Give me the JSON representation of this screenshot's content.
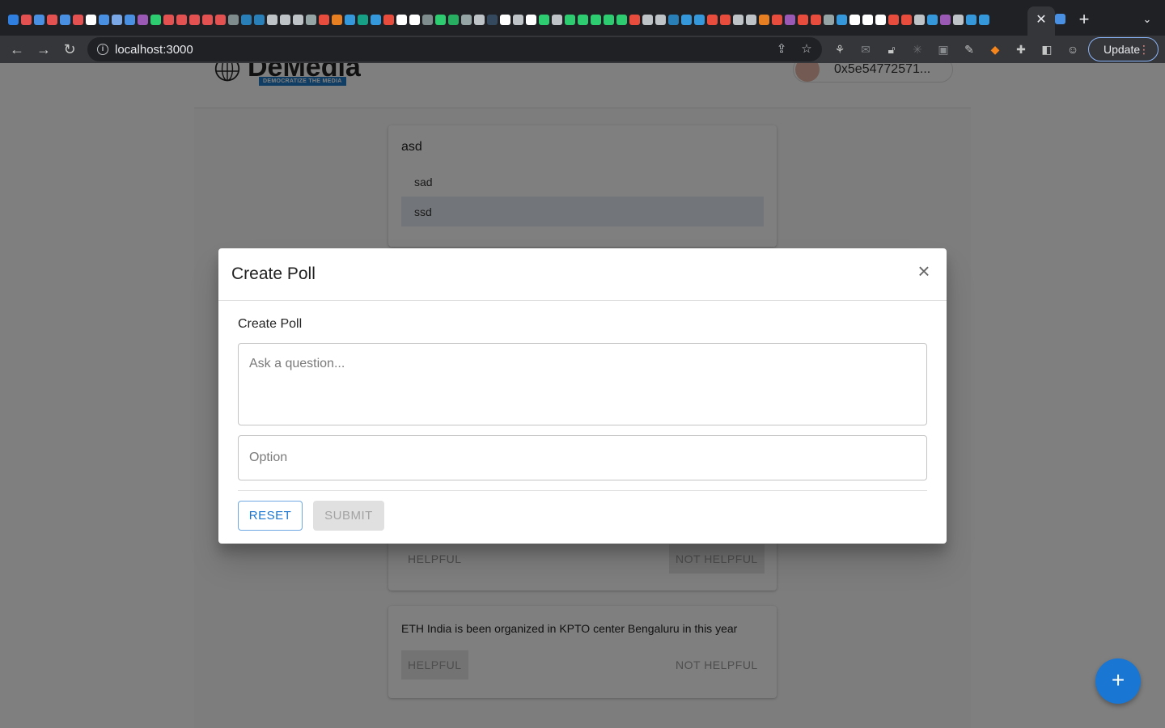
{
  "browser": {
    "url": "localhost:3000",
    "update_label": "Update",
    "favicon_colors": [
      "#2f7fe0",
      "#e35151",
      "#4a90e2",
      "#e35151",
      "#4a90e2",
      "#e35151",
      "#ffffff",
      "#4a90e2",
      "#7aa7e6",
      "#4a90e2",
      "#9b59b6",
      "#2ecc71",
      "#e35151",
      "#e35151",
      "#e35151",
      "#e35151",
      "#e35151",
      "#7f8c8d",
      "#2980b9",
      "#2980b9",
      "#bdc3c7",
      "#bdc3c7",
      "#bdc3c7",
      "#95a5a6",
      "#e74c3c",
      "#e67e22",
      "#3498db",
      "#16a085",
      "#3498db",
      "#e74c3c",
      "#ffffff",
      "#ffffff",
      "#7f8c8d",
      "#2ecc71",
      "#27ae60",
      "#95a5a6",
      "#bdc3c7",
      "#34495e",
      "#ffffff",
      "#bdc3c7",
      "#ffffff",
      "#2ecc71",
      "#bdc3c7",
      "#2ecc71",
      "#2ecc71",
      "#2ecc71",
      "#2ecc71",
      "#2ecc71",
      "#e74c3c",
      "#bdc3c7",
      "#bdc3c7",
      "#2980b9",
      "#3498db",
      "#3498db",
      "#e74c3c",
      "#e74c3c",
      "#bdc3c7",
      "#bdc3c7",
      "#e67e22",
      "#e74c3c",
      "#9b59b6",
      "#e74c3c",
      "#e74c3c",
      "#95a5a6",
      "#3498db",
      "#ffffff",
      "#ffffff",
      "#ffffff",
      "#e74c3c",
      "#e74c3c",
      "#bdc3c7",
      "#3498db",
      "#9b59b6",
      "#bdc3c7",
      "#3498db",
      "#3498db"
    ]
  },
  "app": {
    "logo_text": "DeMedia",
    "logo_tagline": "DEMOCRATIZE THE MEDIA",
    "wallet_address": "0x5e54772571..."
  },
  "feed": {
    "poll": {
      "question": "asd",
      "options": [
        "sad",
        "ssd"
      ]
    },
    "post_partial": {
      "helpful_label": "HELPFUL",
      "not_helpful_label": "NOT HELPFUL"
    },
    "post": {
      "text": "ETH India is been organized in KPTO center Bengaluru in this year",
      "helpful_label": "HELPFUL",
      "not_helpful_label": "NOT HELPFUL"
    },
    "fab_label": "+"
  },
  "dialog": {
    "title": "Create Poll",
    "section_label": "Create Poll",
    "question_placeholder": "Ask a question...",
    "option_placeholder": "Option",
    "reset_label": "RESET",
    "submit_label": "SUBMIT"
  }
}
